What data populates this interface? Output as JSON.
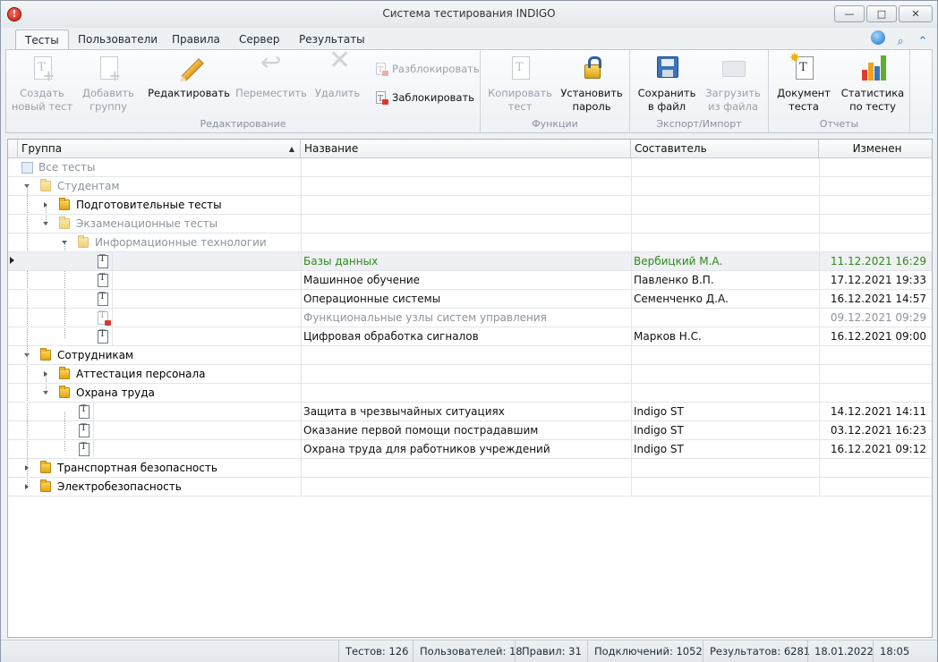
{
  "window": {
    "title": "Система тестирования INDIGO",
    "minimize_glyph": "—",
    "maximize_glyph": "□",
    "close_glyph": "✕"
  },
  "tabs": [
    {
      "label": "Тесты",
      "active": true
    },
    {
      "label": "Пользователи",
      "active": false
    },
    {
      "label": "Правила",
      "active": false
    },
    {
      "label": "Сервер",
      "active": false
    },
    {
      "label": "Результаты",
      "active": false
    }
  ],
  "topright_icons": [
    "globe-icon",
    "zoom-icon",
    "collapse-ribbon-icon"
  ],
  "ribbon": {
    "groups": {
      "editing": "Редактирование",
      "functions": "Функции",
      "export_import": "Экспорт/Импорт",
      "reports": "Отчеты"
    },
    "create_test": {
      "line1": "Создать",
      "line2": "новый тест",
      "enabled": false
    },
    "add_group": {
      "line1": "Добавить",
      "line2": "группу",
      "enabled": false
    },
    "edit": {
      "line1": "Редактировать",
      "enabled": true
    },
    "move": {
      "line1": "Переместить",
      "enabled": false
    },
    "delete": {
      "line1": "Удалить",
      "enabled": false
    },
    "unlock": {
      "label": "Разблокировать",
      "enabled": false
    },
    "lock": {
      "label": "Заблокировать",
      "enabled": true
    },
    "copy_test": {
      "line1": "Копировать",
      "line2": "тест",
      "enabled": false
    },
    "set_password": {
      "line1": "Установить",
      "line2": "пароль",
      "enabled": true
    },
    "save_to_file": {
      "line1": "Сохранить",
      "line2": "в файл",
      "enabled": true
    },
    "load_from_file": {
      "line1": "Загрузить",
      "line2": "из файла",
      "enabled": false
    },
    "test_document": {
      "line1": "Документ",
      "line2": "теста",
      "enabled": true
    },
    "test_statistics": {
      "line1": "Статистика",
      "line2": "по тесту",
      "enabled": true
    },
    "colors": {
      "accent_orange": "#e29a1d",
      "bar_red": "#d9412f",
      "bar_orange": "#f0a11c",
      "bar_green": "#5cae2c"
    }
  },
  "grid": {
    "columns": {
      "group": "Группа",
      "name": "Название",
      "author": "Составитель",
      "modified": "Изменен"
    },
    "rows": {
      "all_tests": {
        "group": "Все тесты"
      },
      "students": {
        "group": "Студентам"
      },
      "prep_tests": {
        "group": "Подготовительные тесты"
      },
      "exam_tests": {
        "group": "Экзаменационные тесты"
      },
      "it": {
        "group": "Информационные технологии"
      },
      "t1": {
        "name": "Базы данных",
        "author": "Вербицкий М.А.",
        "modified": "11.12.2021 16:29"
      },
      "t2": {
        "name": "Машинное обучение",
        "author": "Павленко В.П.",
        "modified": "17.12.2021 19:33"
      },
      "t3": {
        "name": "Операционные системы",
        "author": "Семенченко Д.А.",
        "modified": "16.12.2021 14:57"
      },
      "t4": {
        "name": "Функциональные узлы систем управления",
        "author": "",
        "modified": "09.12.2021 09:29"
      },
      "t5": {
        "name": "Цифровая обработка сигналов",
        "author": "Марков Н.С.",
        "modified": "16.12.2021 09:00"
      },
      "staff": {
        "group": "Сотрудникам"
      },
      "attest": {
        "group": "Аттестация персонала"
      },
      "labor": {
        "group": "Охрана труда"
      },
      "t6": {
        "name": "Защита в чрезвычайных ситуациях",
        "author": "Indigo ST",
        "modified": "14.12.2021 14:11"
      },
      "t7": {
        "name": "Оказание первой помощи пострадавшим",
        "author": "Indigo ST",
        "modified": "03.12.2021 16:23"
      },
      "t8": {
        "name": "Охрана труда для работников учреждений",
        "author": "Indigo ST",
        "modified": "16.12.2021 09:12"
      },
      "transport": {
        "group": "Транспортная безопасность"
      },
      "electro": {
        "group": "Электробезопасность"
      }
    }
  },
  "statusbar": {
    "tests": "Тестов: 126",
    "users": "Пользователей: 18",
    "rules": "Правил: 31",
    "connections": "Подключений: 1052",
    "results": "Результатов: 6281",
    "date": "18.01.2022",
    "time": "18:05"
  }
}
